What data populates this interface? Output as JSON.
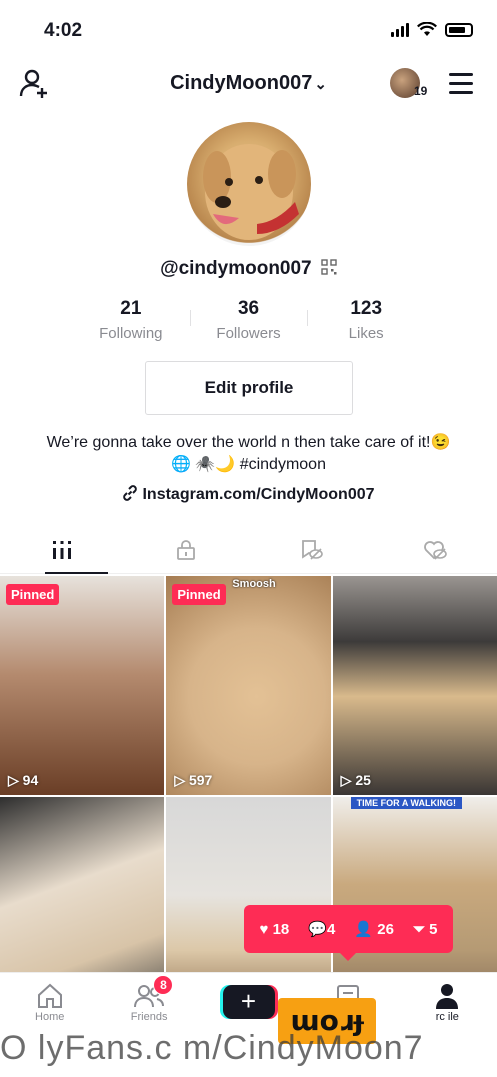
{
  "status": {
    "time": "4:02"
  },
  "header": {
    "username": "CindyMoon007",
    "visitor_count": "19"
  },
  "profile": {
    "handle": "@cindymoon007",
    "stats": [
      {
        "value": "21",
        "label": "Following"
      },
      {
        "value": "36",
        "label": "Followers"
      },
      {
        "value": "123",
        "label": "Likes"
      }
    ],
    "edit_label": "Edit profile",
    "bio": "We’re gonna take over the world n then take care of it!😉 🌐 🕷️🌙 #cindymoon",
    "link": "Instagram.com/CindyMoon007"
  },
  "videos": [
    {
      "badge": "Pinned",
      "views": "94",
      "color": "#b48a6e"
    },
    {
      "badge": "Pinned",
      "views": "597",
      "caption": "Smoosh",
      "color": "#d7b48a"
    },
    {
      "views": "25",
      "color": "#6f6a66"
    },
    {
      "color": "#c9c3bd"
    },
    {
      "color": "#dcc8a8"
    },
    {
      "caption": "TIME FOR A WALKING!",
      "color": "#b59a74"
    }
  ],
  "notification": {
    "likes": "18",
    "comments": "4",
    "followers": "26",
    "mentions": "5"
  },
  "bottom_nav": {
    "home": "Home",
    "friends": "Friends",
    "friends_badge": "8",
    "profile": "rc ile"
  },
  "overlay": {
    "sticker": "ɯoɹɟ",
    "watermark": "O lyFans.c m/CindyMoon7"
  },
  "colors": {
    "accent": "#fe2c55",
    "text": "#161823",
    "muted": "#8a8b91"
  }
}
